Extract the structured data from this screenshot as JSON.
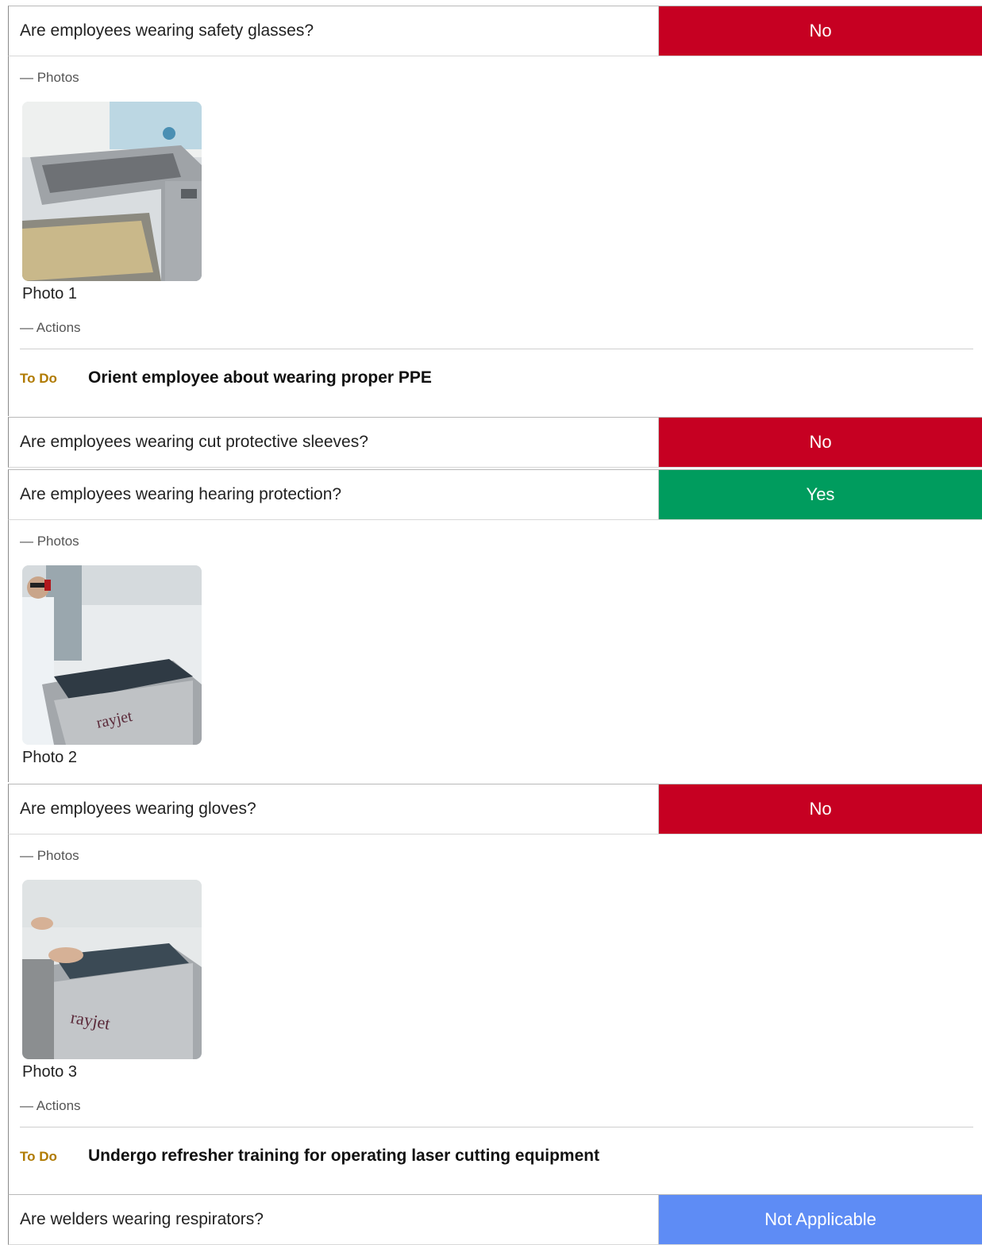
{
  "items": [
    {
      "question": "Are employees wearing safety glasses?",
      "response": "No",
      "photos_label": "— Photos",
      "photo_caption": "Photo 1",
      "actions_label": "— Actions",
      "action_status": "To Do",
      "action_title": "Orient employee about wearing proper PPE"
    },
    {
      "question": "Are employees wearing cut protective sleeves?",
      "response": "No"
    },
    {
      "question": "Are employees wearing hearing protection?",
      "response": "Yes",
      "photos_label": "— Photos",
      "photo_caption": "Photo 2"
    },
    {
      "question": "Are employees wearing gloves?",
      "response": "No",
      "photos_label": "— Photos",
      "photo_caption": "Photo 3",
      "actions_label": "— Actions",
      "action_status": "To Do",
      "action_title": "Undergo refresher training for operating laser cutting equipment"
    },
    {
      "question": "Are welders wearing respirators?",
      "response": "Not Applicable"
    }
  ],
  "colors": {
    "no": "#c60022",
    "yes": "#009c5e",
    "not_applicable": "#5e8cf5",
    "todo": "#b07a00"
  }
}
